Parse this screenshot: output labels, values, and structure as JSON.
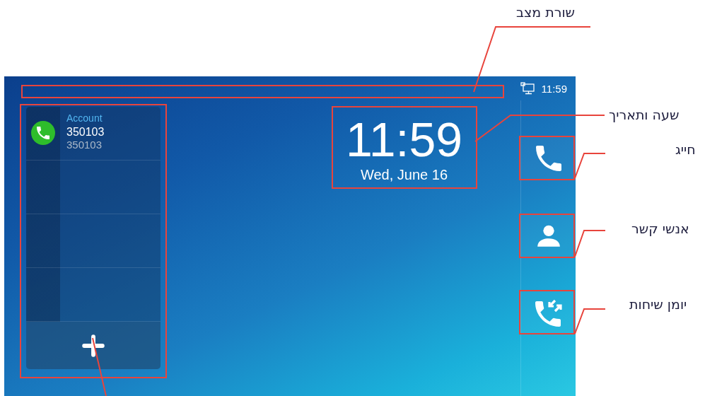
{
  "status_bar": {
    "time": "11:59"
  },
  "account_panel": {
    "accounts": [
      {
        "label": "Account",
        "name": "350103",
        "number": "350103"
      }
    ]
  },
  "clock": {
    "time": "11:59",
    "date": "Wed, June 16"
  },
  "side_buttons": [
    {
      "kind": "dial"
    },
    {
      "kind": "contacts"
    },
    {
      "kind": "history"
    }
  ],
  "annotations": [
    {
      "label": "שורת מצב"
    },
    {
      "label": "שעה ותאריך"
    },
    {
      "label": "חייג"
    },
    {
      "label": "אנשי קשר"
    },
    {
      "label": "יומן שיחות"
    }
  ]
}
